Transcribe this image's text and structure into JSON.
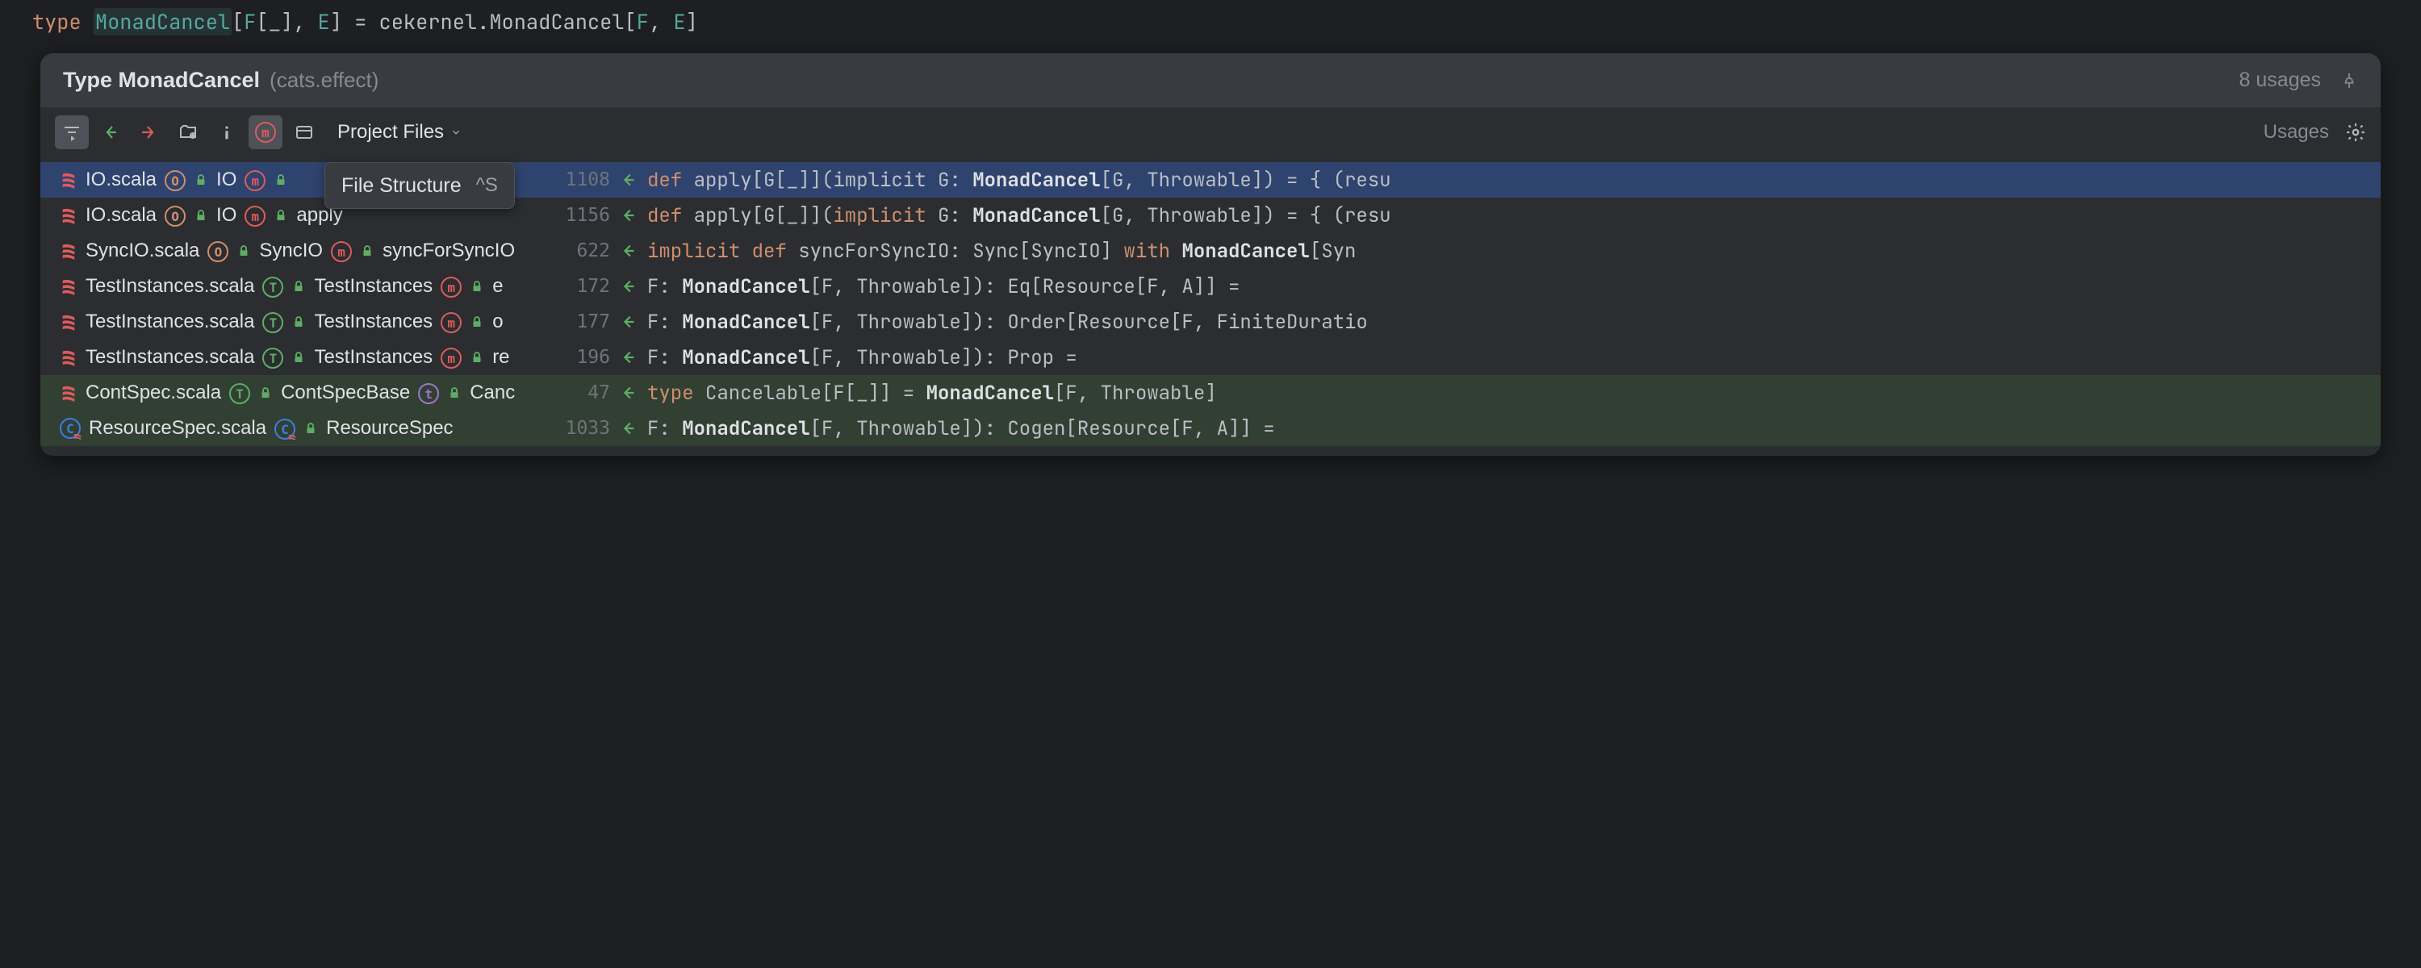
{
  "editor": {
    "code_html": "<span class='kw-type'>type</span> <span class='kw-name'>MonadCancel</span><span class='punct'>[</span><span class='type-param'>F</span><span class='punct'>[_], </span><span class='type-param'>E</span><span class='punct'>] = cekernel.MonadCancel[</span><span class='type-param'>F</span><span class='punct'>, </span><span class='type-param'>E</span><span class='punct'>]</span>"
  },
  "popup": {
    "title": "Type MonadCancel",
    "subtitle": "(cats.effect)",
    "usage_count": "8 usages",
    "usages_label": "Usages",
    "scope": "Project Files"
  },
  "tooltip": {
    "text": "File Structure",
    "shortcut": "^S"
  },
  "rows": [
    {
      "file": "IO.scala",
      "badges": [
        {
          "t": "O"
        },
        {
          "lock": true
        }
      ],
      "class": "IO",
      "class_badges": [
        {
          "t": "m"
        },
        {
          "lock": true
        }
      ],
      "tail": "",
      "line": "1108",
      "code": "<span class='kw'>def</span> apply[G[_]](implicit G: <span class='hl'>MonadCancel</span>[G, Throwable]) = { (resu",
      "selected": true
    },
    {
      "file": "IO.scala",
      "badges": [
        {
          "t": "O"
        },
        {
          "lock": true
        }
      ],
      "class": "IO",
      "class_badges": [
        {
          "t": "m"
        },
        {
          "lock": true
        }
      ],
      "tail": "apply",
      "line": "1156",
      "code": "<span class='kw'>def</span> apply[G[_]](<span class='kw'>implicit</span> G: <span class='hl'>MonadCancel</span>[G, Throwable]) = { (resu"
    },
    {
      "file": "SyncIO.scala",
      "badges": [
        {
          "t": "O"
        },
        {
          "lock": true
        }
      ],
      "class": "SyncIO",
      "class_badges": [
        {
          "t": "m"
        },
        {
          "lock": true
        }
      ],
      "tail": "syncForSyncIO",
      "line": "622",
      "code": "<span class='kw'>implicit def</span> syncForSyncIO: Sync[SyncIO] <span class='kw'>with</span> <span class='hl'>MonadCancel</span>[Syn"
    },
    {
      "file": "TestInstances.scala",
      "badges": [
        {
          "t": "T"
        },
        {
          "lock": true
        }
      ],
      "class": "TestInstances",
      "class_badges": [
        {
          "t": "m"
        },
        {
          "lock": true
        }
      ],
      "tail": "e",
      "line": "172",
      "code": "F: <span class='hl'>MonadCancel</span>[F, Throwable]): Eq[Resource[F, A]] ="
    },
    {
      "file": "TestInstances.scala",
      "badges": [
        {
          "t": "T"
        },
        {
          "lock": true
        }
      ],
      "class": "TestInstances",
      "class_badges": [
        {
          "t": "m"
        },
        {
          "lock": true
        }
      ],
      "tail": "o",
      "line": "177",
      "code": "F: <span class='hl'>MonadCancel</span>[F, Throwable]): Order[Resource[F, FiniteDuratio"
    },
    {
      "file": "TestInstances.scala",
      "badges": [
        {
          "t": "T"
        },
        {
          "lock": true
        }
      ],
      "class": "TestInstances",
      "class_badges": [
        {
          "t": "m"
        },
        {
          "lock": true
        }
      ],
      "tail": "re",
      "line": "196",
      "code": "F: <span class='hl'>MonadCancel</span>[F, Throwable]): Prop ="
    },
    {
      "file": "ContSpec.scala",
      "badges": [
        {
          "t": "T"
        },
        {
          "lock": true
        }
      ],
      "class": "ContSpecBase",
      "class_badges": [
        {
          "t": "t"
        },
        {
          "lock": true
        }
      ],
      "tail": "Canc",
      "line": "47",
      "code": "<span class='kw'>type</span> Cancelable[F[_]] = <span class='hl'>MonadCancel</span>[F, Throwable]",
      "green": true
    },
    {
      "file": "ResourceSpec.scala",
      "file_icon": "C",
      "badges": [
        {
          "t": "Cs"
        },
        {
          "lock": true
        }
      ],
      "class": "ResourceSpec",
      "class_badges": [],
      "tail": "",
      "line": "1033",
      "code": "F: <span class='hl'>MonadCancel</span>[F, Throwable]): Cogen[Resource[F, A]] =",
      "green": true
    }
  ]
}
